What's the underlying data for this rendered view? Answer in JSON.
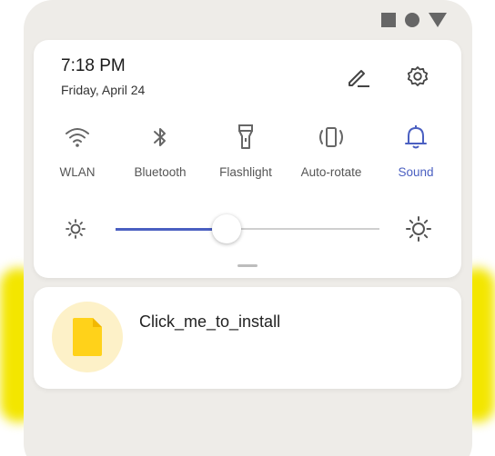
{
  "status_bar": {
    "icons": [
      "square-icon",
      "circle-icon",
      "triangle-icon"
    ]
  },
  "header": {
    "time": "7:18 PM",
    "date": "Friday, April 24",
    "edit_icon": "pencil-icon",
    "settings_icon": "gear-icon"
  },
  "tiles": [
    {
      "label": "WLAN",
      "icon": "wifi-icon",
      "active": false
    },
    {
      "label": "Bluetooth",
      "icon": "bluetooth-icon",
      "active": false
    },
    {
      "label": "Flashlight",
      "icon": "flashlight-icon",
      "active": false
    },
    {
      "label": "Auto-rotate",
      "icon": "auto-rotate-icon",
      "active": false
    },
    {
      "label": "Sound",
      "icon": "bell-icon",
      "active": true
    }
  ],
  "brightness": {
    "level": 0.42
  },
  "notification": {
    "title": "Click_me_to_install",
    "icon": "file-icon"
  },
  "colors": {
    "accent": "#4a5fc1",
    "notification_icon": "#ffd21a",
    "notification_icon_bg": "#fdf1c8",
    "glow": "#f3e600"
  }
}
